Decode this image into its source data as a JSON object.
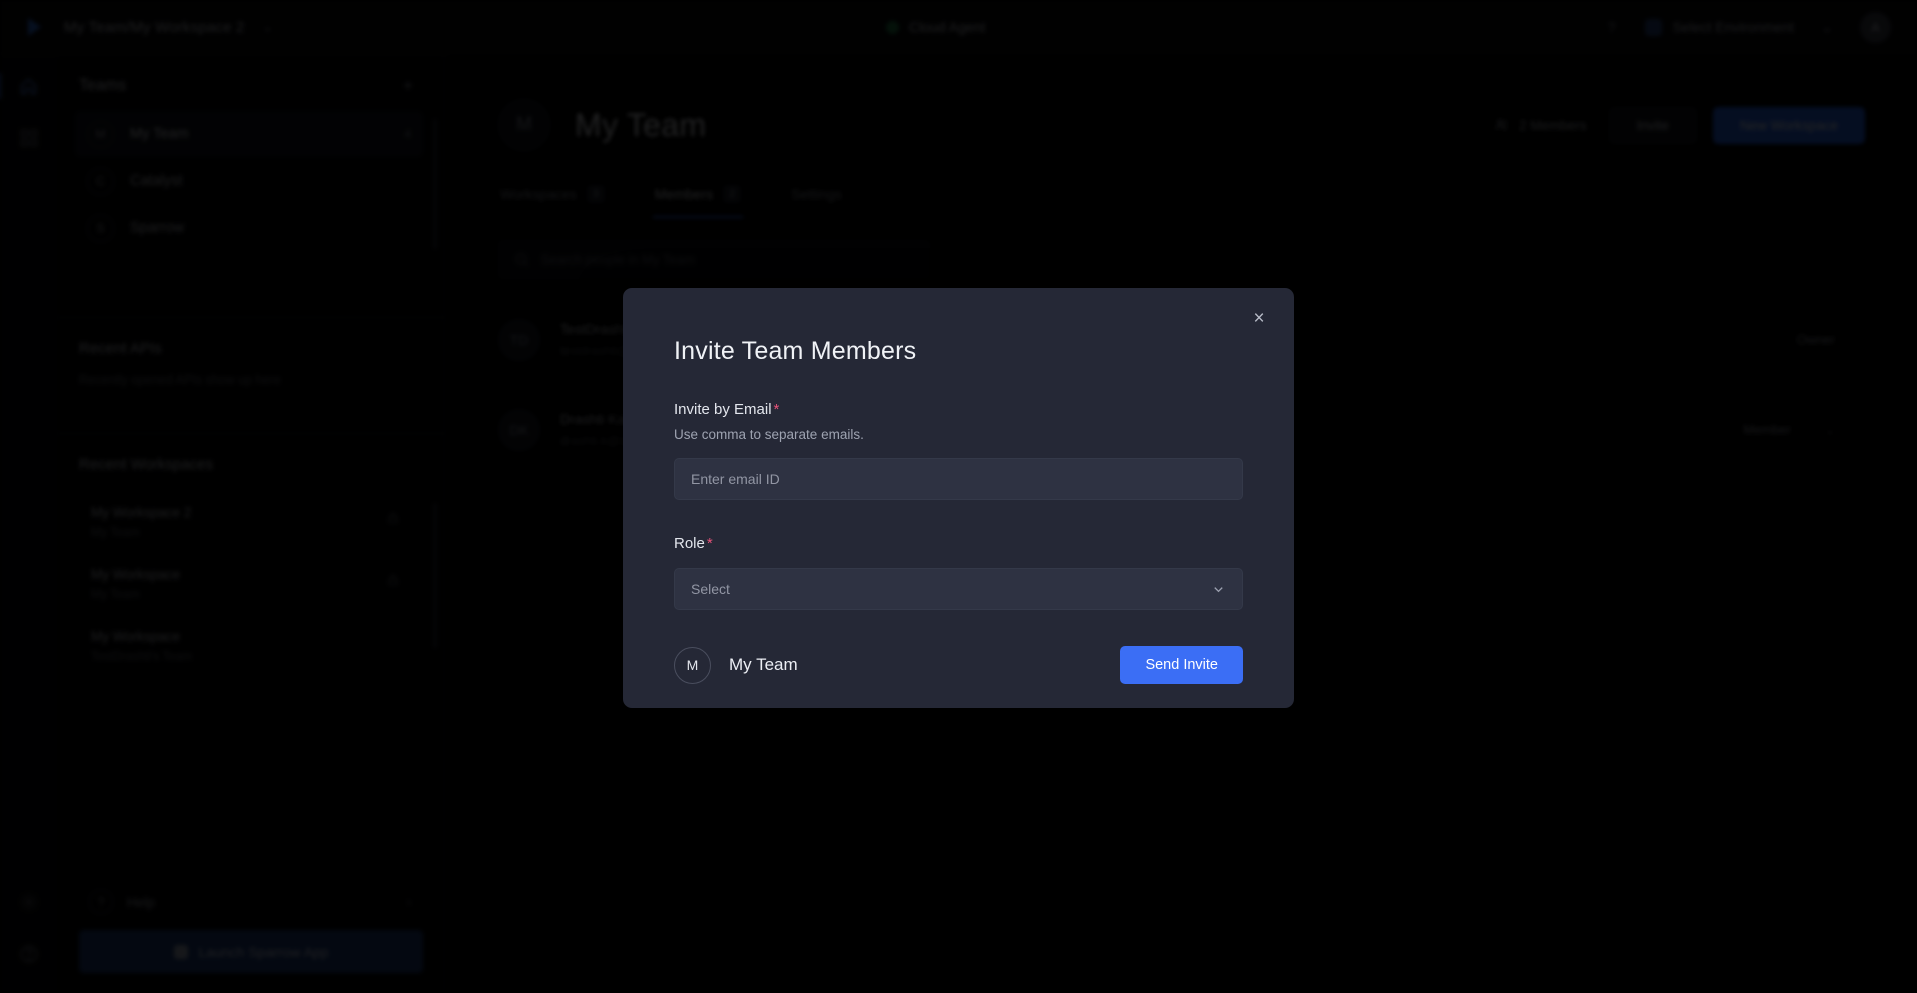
{
  "topbar": {
    "logo": "sparrow-logo",
    "breadcrumb": "My Team/My Workspace 2",
    "breadcrumb_caret": "⌄",
    "cloud_agent_label": "Cloud Agent",
    "status_color": "#1f7a46",
    "help_icon": "?",
    "environment_label": "Select Environment",
    "environment_caret": "⌄",
    "avatar_initial": "A"
  },
  "rail": {
    "items": [
      {
        "name": "home-icon",
        "active": true
      },
      {
        "name": "grid-icon",
        "active": false
      }
    ],
    "bottom_items": [
      {
        "name": "settings-icon"
      },
      {
        "name": "help-circle-icon"
      }
    ]
  },
  "sidebar": {
    "teams_heading": "Teams",
    "add_team_icon": "+",
    "teams": [
      {
        "initial": "M",
        "name": "My Team",
        "count": "4",
        "active": true
      },
      {
        "initial": "C",
        "name": "Catalyst",
        "count": "",
        "active": false
      },
      {
        "initial": "S",
        "name": "Sparrow",
        "count": "",
        "active": false
      }
    ],
    "recent_apis": {
      "title": "Recent APIs",
      "empty_text": "Recently opened APIs show up here"
    },
    "recent_workspaces": {
      "title": "Recent Workspaces",
      "items": [
        {
          "name": "My Workspace 2",
          "team": "My Team",
          "lock": "private"
        },
        {
          "name": "My Workspace",
          "team": "My Team",
          "lock": "private"
        },
        {
          "name": "My Workspace",
          "team": "TestDrashti's Team",
          "lock": ""
        }
      ]
    },
    "footer": {
      "help_label": "Help",
      "help_caret": "›",
      "launch_label": "Launch Sparrow App"
    }
  },
  "main": {
    "team_initial": "M",
    "team_title": "My Team",
    "members_count_label": "2 Members",
    "invite_button": "Invite",
    "new_workspace_button": "New Workspace",
    "tabs": [
      {
        "label": "Workspaces",
        "badge": "3",
        "active": false
      },
      {
        "label": "Members",
        "badge": "2",
        "active": true
      },
      {
        "label": "Settings",
        "badge": "",
        "active": false
      }
    ],
    "search_placeholder": "Search people in My Team",
    "members": [
      {
        "initial": "TD",
        "name": "TestDrashti",
        "email": "testdrashti@gmail.com",
        "role": "Owner",
        "has_caret": false
      },
      {
        "initial": "DK",
        "name": "Drashti Kalathiya",
        "email": "drashti.k@sparrow.com",
        "role": "Member",
        "has_caret": true
      }
    ]
  },
  "modal": {
    "title": "Invite Team Members",
    "close_icon": "×",
    "email_label": "Invite by Email",
    "email_required": "*",
    "email_help": "Use comma to separate emails.",
    "email_placeholder": "Enter email ID",
    "email_value": "",
    "role_label": "Role",
    "role_required": "*",
    "role_selected": "Select",
    "role_caret": "⌄",
    "team_initial": "M",
    "team_name": "My Team",
    "send_button": "Send Invite",
    "accent_color": "#3b6ef5",
    "background_color": "#252836"
  }
}
